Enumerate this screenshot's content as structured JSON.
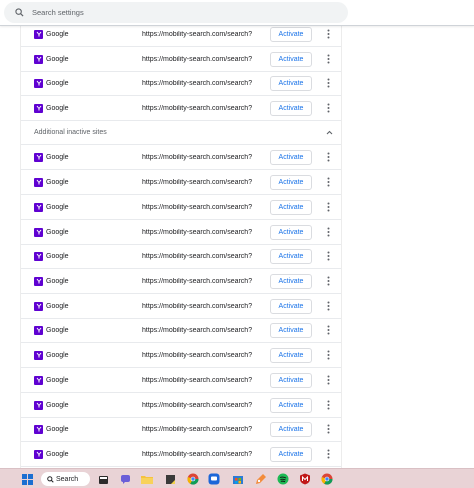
{
  "search": {
    "placeholder": "Search settings"
  },
  "active_rows": [
    {
      "name": "Google",
      "url": "https://mobility-search.com/search?s",
      "action": "Activate"
    },
    {
      "name": "Google",
      "url": "https://mobility-search.com/search?s",
      "action": "Activate"
    },
    {
      "name": "Google",
      "url": "https://mobility-search.com/search?s",
      "action": "Activate"
    },
    {
      "name": "Google",
      "url": "https://mobility-search.com/search?s",
      "action": "Activate"
    }
  ],
  "inactive_section": {
    "title": "Additional inactive sites"
  },
  "inactive_rows": [
    {
      "name": "Google",
      "url": "https://mobility-search.com/search?s",
      "action": "Activate"
    },
    {
      "name": "Google",
      "url": "https://mobility-search.com/search?s",
      "action": "Activate"
    },
    {
      "name": "Google",
      "url": "https://mobility-search.com/search?s",
      "action": "Activate"
    },
    {
      "name": "Google",
      "url": "https://mobility-search.com/search?s",
      "action": "Activate"
    },
    {
      "name": "Google",
      "url": "https://mobility-search.com/search?s",
      "action": "Activate"
    },
    {
      "name": "Google",
      "url": "https://mobility-search.com/search?s",
      "action": "Activate"
    },
    {
      "name": "Google",
      "url": "https://mobility-search.com/search?s",
      "action": "Activate"
    },
    {
      "name": "Google",
      "url": "https://mobility-search.com/search?s",
      "action": "Activate"
    },
    {
      "name": "Google",
      "url": "https://mobility-search.com/search?s",
      "action": "Activate"
    },
    {
      "name": "Google",
      "url": "https://mobility-search.com/search?s",
      "action": "Activate"
    },
    {
      "name": "Google",
      "url": "https://mobility-search.com/search?s",
      "action": "Activate"
    },
    {
      "name": "Google",
      "url": "https://mobility-search.com/search?s",
      "action": "Activate"
    },
    {
      "name": "Google",
      "url": "https://mobility-search.com/search?s",
      "action": "Activate"
    }
  ],
  "taskbar": {
    "search_label": "Search",
    "apps": [
      "windows-start-icon",
      "file-explorer-icon",
      "chat-icon",
      "folder-icon",
      "sticky-notes-icon",
      "chrome-icon",
      "messenger-icon",
      "store-icon",
      "paint-icon",
      "spotify-icon",
      "mcafee-icon",
      "chrome-icon"
    ]
  },
  "colors": {
    "favicon": "#5f01d1",
    "activate_text": "#1a73e8",
    "taskbar": "#e9d3d6"
  }
}
